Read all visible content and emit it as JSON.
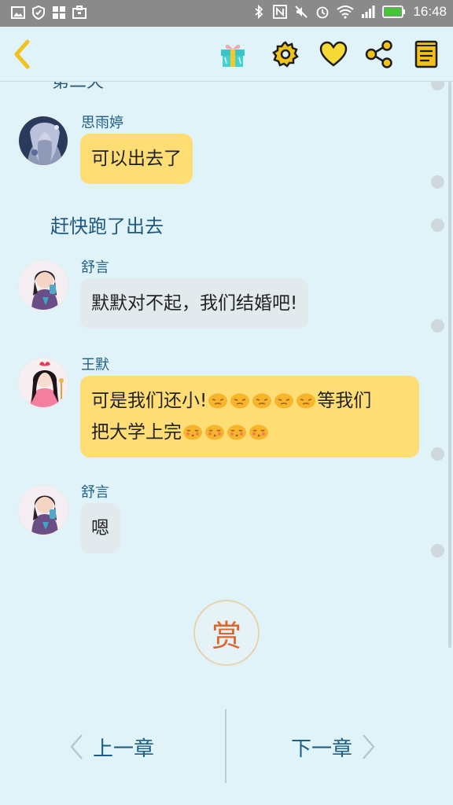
{
  "status_bar": {
    "time": "16:48",
    "battery_color": "#44c637"
  },
  "toolbar": {
    "back_icon": "chevron-left-icon",
    "gift_icon": "gift-icon",
    "settings_icon": "gear-icon",
    "like_icon": "heart-icon",
    "share_icon": "share-icon",
    "catalog_icon": "book-icon",
    "accent_color": "#f2c11a"
  },
  "chat": {
    "partial_heading": "第二天",
    "messages": [
      {
        "type": "bubble",
        "name": "思雨婷",
        "lines": [
          "可以出去了"
        ],
        "color": "yellow"
      },
      {
        "type": "narration",
        "text": "赶快跑了出去"
      },
      {
        "type": "bubble",
        "name": "舒言",
        "lines": [
          "默默对不起，我们结婚吧!"
        ],
        "color": "gray"
      },
      {
        "type": "bubble",
        "name": "王默",
        "line1": "可是我们还小!",
        "line1_end": "等我们",
        "line2": "把大学上完",
        "color": "yellow"
      },
      {
        "type": "bubble",
        "name": "舒言",
        "lines": [
          "嗯"
        ],
        "color": "gray"
      }
    ]
  },
  "reward": {
    "label": "赏"
  },
  "chapter_nav": {
    "prev_label": "上一章",
    "next_label": "下一章"
  }
}
